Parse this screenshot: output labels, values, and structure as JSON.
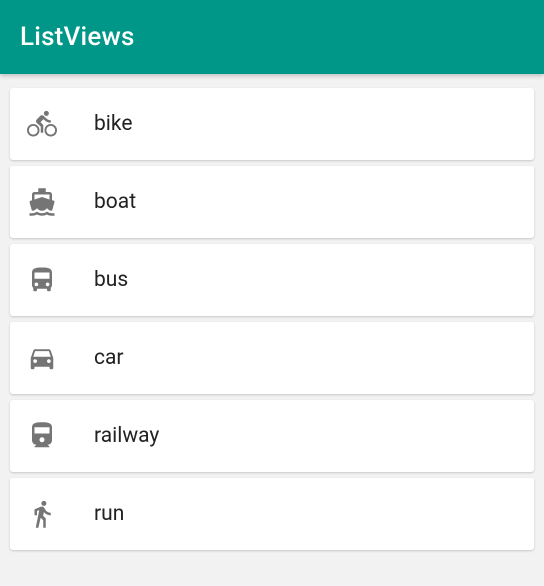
{
  "app": {
    "title": "ListViews"
  },
  "list": {
    "items": [
      {
        "icon": "bike",
        "label": "bike"
      },
      {
        "icon": "boat",
        "label": "boat"
      },
      {
        "icon": "bus",
        "label": "bus"
      },
      {
        "icon": "car",
        "label": "car"
      },
      {
        "icon": "railway",
        "label": "railway"
      },
      {
        "icon": "run",
        "label": "run"
      }
    ]
  },
  "colors": {
    "primary": "#009688",
    "background": "#f2f2f2",
    "icon": "#757575"
  }
}
